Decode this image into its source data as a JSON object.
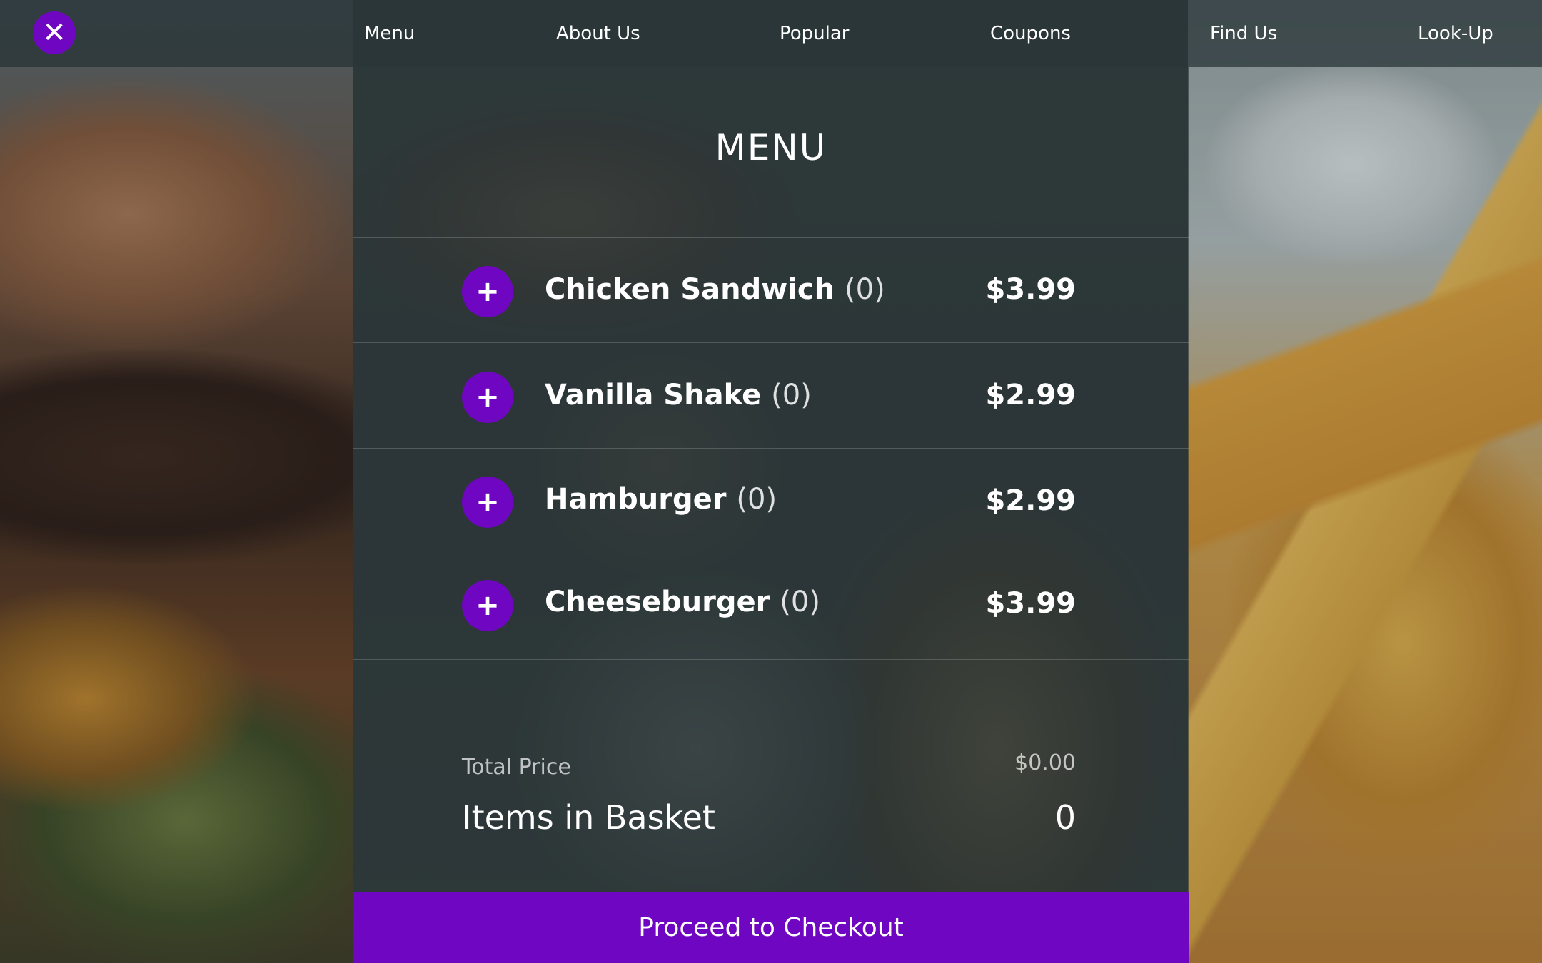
{
  "nav": {
    "close_icon": "close-icon",
    "items": [
      "Menu",
      "About Us",
      "Popular",
      "Coupons",
      "Find Us",
      "Look-Up"
    ]
  },
  "panel": {
    "title": "MENU",
    "items": [
      {
        "name": "Chicken Sandwich",
        "qty": "(0)",
        "price": "$3.99"
      },
      {
        "name": "Vanilla Shake",
        "qty": "(0)",
        "price": "$2.99"
      },
      {
        "name": "Hamburger",
        "qty": "(0)",
        "price": "$2.99"
      },
      {
        "name": "Cheeseburger",
        "qty": "(0)",
        "price": "$3.99"
      }
    ],
    "add_icon": "plus-icon",
    "total_label": "Total Price",
    "total_value": "$0.00",
    "basket_label": "Items in Basket",
    "basket_value": "0",
    "checkout_label": "Proceed to Checkout"
  },
  "colors": {
    "accent": "#6f06c1"
  }
}
